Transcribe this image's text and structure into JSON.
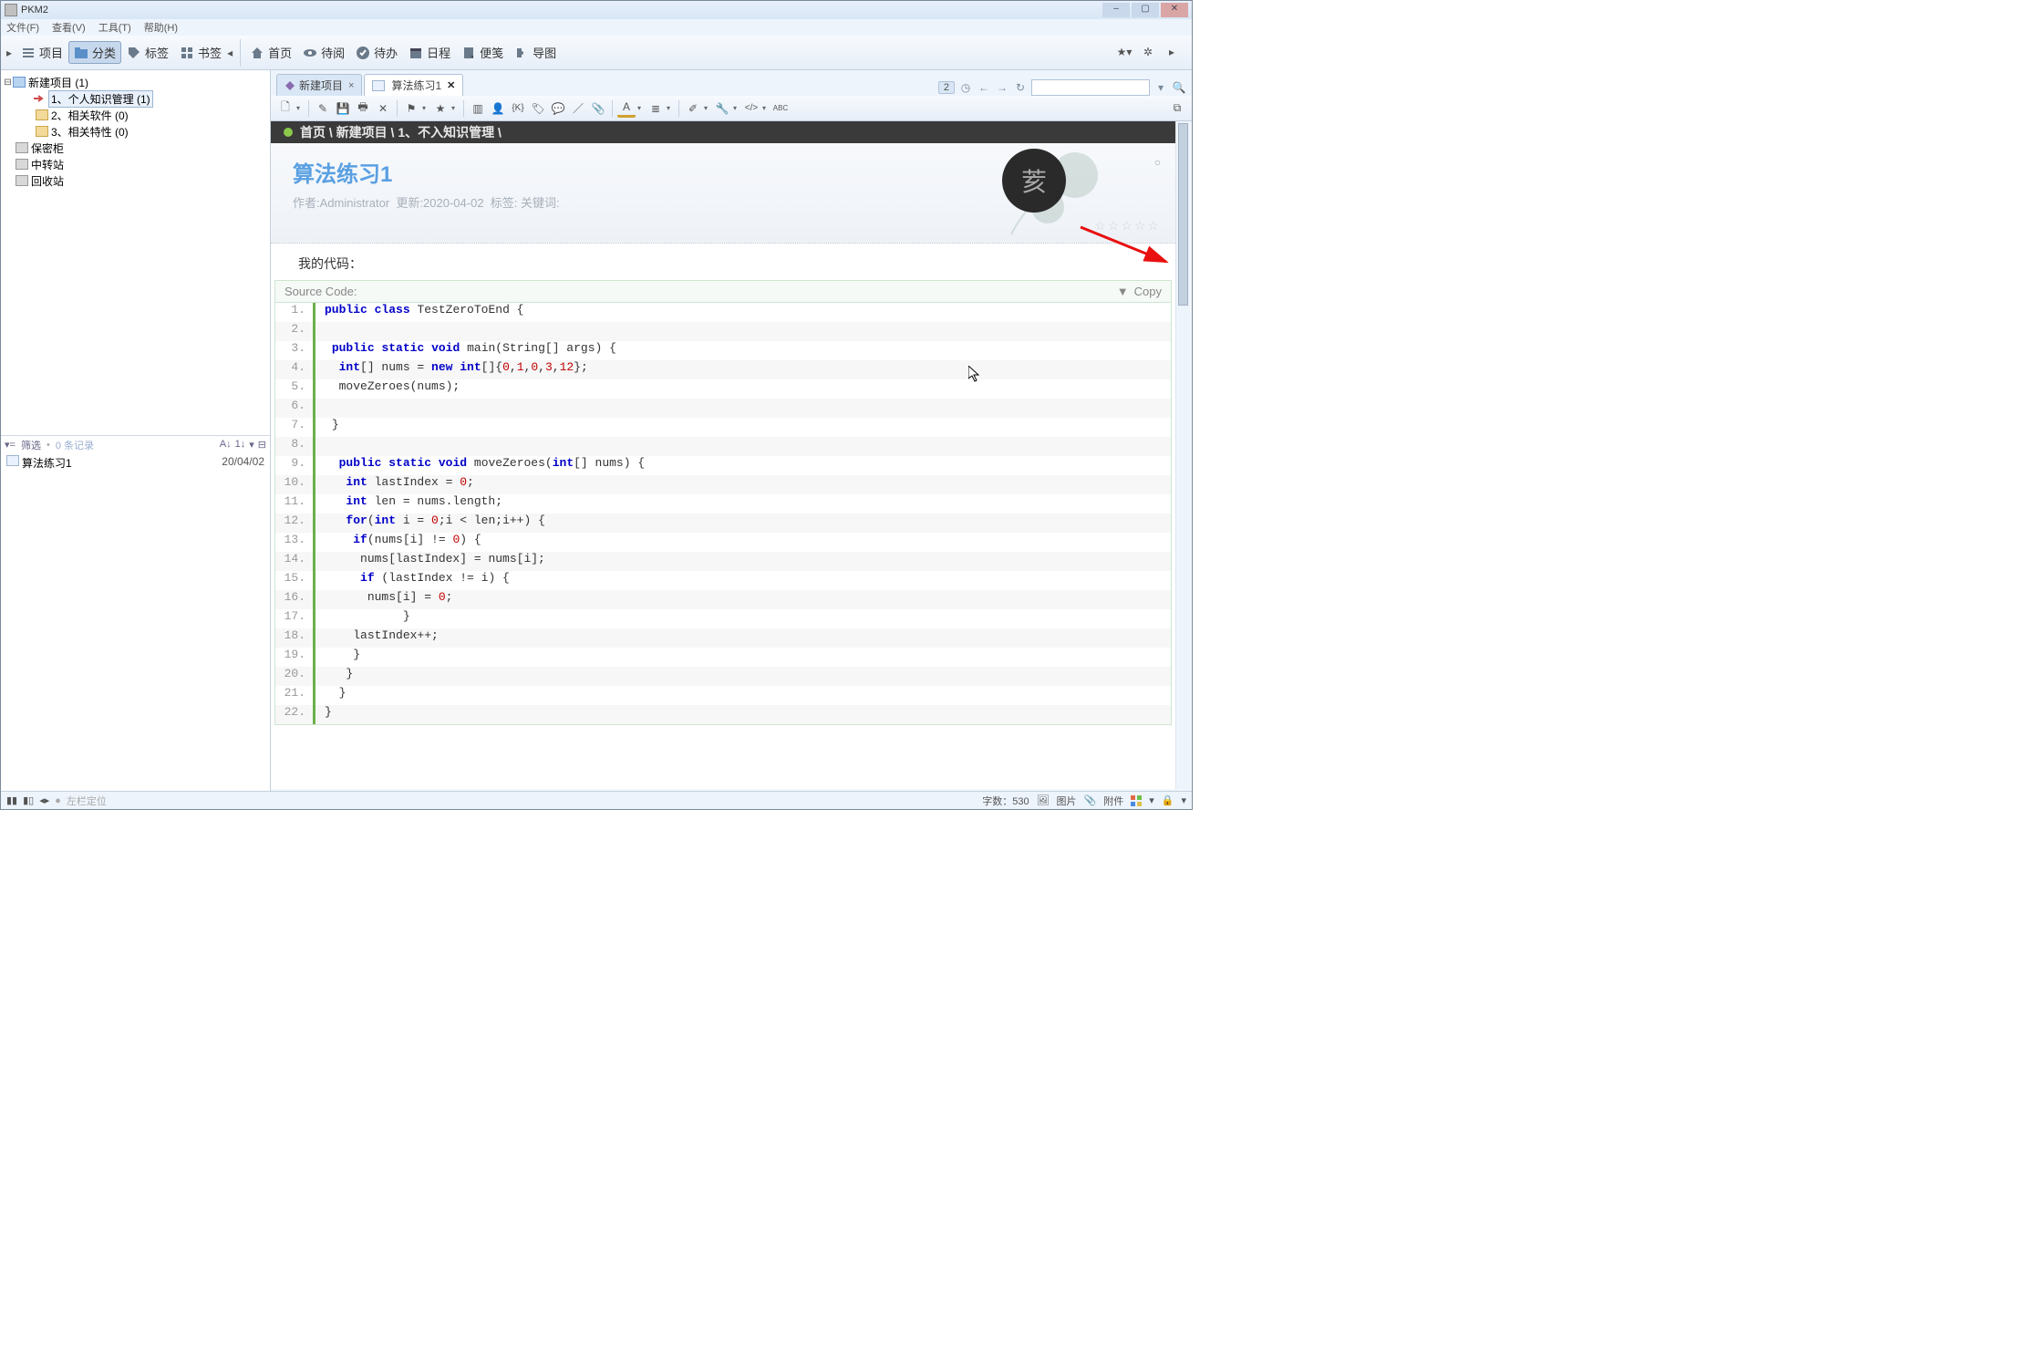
{
  "app_title": "PKM2",
  "menubar": [
    "文件(F)",
    "查看(V)",
    "工具(T)",
    "帮助(H)"
  ],
  "left_tabs": [
    {
      "icon": "list",
      "label": "项目"
    },
    {
      "icon": "folder",
      "label": "分类"
    },
    {
      "icon": "tag",
      "label": "标签"
    },
    {
      "icon": "grid",
      "label": "书签"
    }
  ],
  "right_tabs": [
    {
      "icon": "home",
      "label": "首页"
    },
    {
      "icon": "eye",
      "label": "待阅"
    },
    {
      "icon": "check",
      "label": "待办"
    },
    {
      "icon": "cal",
      "label": "日程"
    },
    {
      "icon": "note",
      "label": "便笺"
    },
    {
      "icon": "puzzle",
      "label": "导图"
    }
  ],
  "tree": {
    "root": "新建项目 (1)",
    "children": [
      "1、个人知识管理 (1)",
      "2、相关软件 (0)",
      "3、相关特性 (0)"
    ],
    "extra": [
      "保密柜",
      "中转站",
      "回收站"
    ]
  },
  "filter": {
    "label": "筛选",
    "records": "0 条记录"
  },
  "list_item": {
    "name": "算法练习1",
    "date": "20/04/02"
  },
  "doc_tabs": [
    {
      "label": "新建项目",
      "close": "×",
      "active": false
    },
    {
      "label": "算法练习1",
      "close": "✕",
      "active": true
    }
  ],
  "nav_count": "2",
  "crumb": "首页 \\ 新建项目 \\ 1、不入知识管理 \\",
  "doc": {
    "title": "算法练习1",
    "author": "作者:Administrator",
    "updated": "更新:2020-04-02",
    "tags": "标签:",
    "keywords": "关键词:",
    "section": "我的代码：",
    "code_header": "Source Code:",
    "copy": "Copy"
  },
  "code_lines": [
    [
      [
        "kw",
        "public"
      ],
      [
        "sp",
        " "
      ],
      [
        "kw",
        "class"
      ],
      [
        "sp",
        " "
      ],
      [
        "cn",
        "TestZeroToEnd {"
      ]
    ],
    [],
    [
      [
        "sp",
        " "
      ],
      [
        "kw",
        "public"
      ],
      [
        "sp",
        " "
      ],
      [
        "kw",
        "static"
      ],
      [
        "sp",
        " "
      ],
      [
        "kw",
        "void"
      ],
      [
        "sp",
        " "
      ],
      [
        "cn",
        "main(String[] args) {"
      ]
    ],
    [
      [
        "sp",
        "  "
      ],
      [
        "kw",
        "int"
      ],
      [
        "cn",
        "[] nums = "
      ],
      [
        "kw",
        "new"
      ],
      [
        "sp",
        " "
      ],
      [
        "kw",
        "int"
      ],
      [
        "cn",
        "[]{"
      ],
      [
        "num",
        "0"
      ],
      [
        "cn",
        ","
      ],
      [
        "num",
        "1"
      ],
      [
        "cn",
        ","
      ],
      [
        "num",
        "0"
      ],
      [
        "cn",
        ","
      ],
      [
        "num",
        "3"
      ],
      [
        "cn",
        ","
      ],
      [
        "num",
        "12"
      ],
      [
        "cn",
        "};"
      ]
    ],
    [
      [
        "sp",
        "  "
      ],
      [
        "cn",
        "moveZeroes(nums);"
      ]
    ],
    [],
    [
      [
        "sp",
        " "
      ],
      [
        "cn",
        "}"
      ]
    ],
    [],
    [
      [
        "sp",
        "  "
      ],
      [
        "kw",
        "public"
      ],
      [
        "sp",
        " "
      ],
      [
        "kw",
        "static"
      ],
      [
        "sp",
        " "
      ],
      [
        "kw",
        "void"
      ],
      [
        "sp",
        " "
      ],
      [
        "cn",
        "moveZeroes("
      ],
      [
        "kw",
        "int"
      ],
      [
        "cn",
        "[] nums) {"
      ]
    ],
    [
      [
        "sp",
        "   "
      ],
      [
        "kw",
        "int"
      ],
      [
        "cn",
        " lastIndex = "
      ],
      [
        "num",
        "0"
      ],
      [
        "cn",
        ";"
      ]
    ],
    [
      [
        "sp",
        "   "
      ],
      [
        "kw",
        "int"
      ],
      [
        "cn",
        " len = nums.length;"
      ]
    ],
    [
      [
        "sp",
        "   "
      ],
      [
        "kw",
        "for"
      ],
      [
        "cn",
        "("
      ],
      [
        "kw",
        "int"
      ],
      [
        "cn",
        " i = "
      ],
      [
        "num",
        "0"
      ],
      [
        "cn",
        ";i < len;i++) {"
      ]
    ],
    [
      [
        "sp",
        "    "
      ],
      [
        "kw",
        "if"
      ],
      [
        "cn",
        "(nums[i] != "
      ],
      [
        "num",
        "0"
      ],
      [
        "cn",
        ") {"
      ]
    ],
    [
      [
        "sp",
        "     "
      ],
      [
        "cn",
        "nums[lastIndex] = nums[i];"
      ]
    ],
    [
      [
        "sp",
        "     "
      ],
      [
        "kw",
        "if"
      ],
      [
        "cn",
        " (lastIndex != i) {"
      ]
    ],
    [
      [
        "sp",
        "      "
      ],
      [
        "cn",
        "nums[i] = "
      ],
      [
        "num",
        "0"
      ],
      [
        "cn",
        ";"
      ]
    ],
    [
      [
        "sp",
        "           "
      ],
      [
        "cn",
        "}"
      ]
    ],
    [
      [
        "sp",
        "    "
      ],
      [
        "cn",
        "lastIndex++;"
      ]
    ],
    [
      [
        "sp",
        "    "
      ],
      [
        "cn",
        "}"
      ]
    ],
    [
      [
        "sp",
        "   "
      ],
      [
        "cn",
        "}"
      ]
    ],
    [
      [
        "sp",
        "  "
      ],
      [
        "cn",
        "}"
      ]
    ],
    [
      [
        "cn",
        "}"
      ]
    ]
  ],
  "status": {
    "left_loc": "左栏定位",
    "word_count": "字数：530",
    "image": "图片",
    "attachment": "附件"
  }
}
